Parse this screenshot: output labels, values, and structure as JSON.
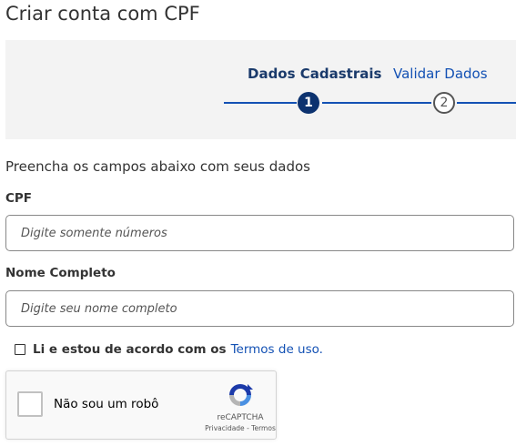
{
  "page": {
    "title": "Criar conta com CPF"
  },
  "stepper": {
    "steps": [
      {
        "label": "Dados Cadastrais",
        "number": "1",
        "state": "active"
      },
      {
        "label": "Validar Dados",
        "number": "2",
        "state": "inactive"
      }
    ]
  },
  "form": {
    "intro": "Preencha os campos abaixo com seus dados",
    "cpf": {
      "label": "CPF",
      "placeholder": "Digite somente números",
      "value": ""
    },
    "nome": {
      "label": "Nome Completo",
      "placeholder": "Digite seu nome completo",
      "value": ""
    },
    "terms": {
      "text": "Li e estou de acordo com os",
      "link": "Termos de uso.",
      "checked": false
    }
  },
  "captcha": {
    "label": "Não sou um robô",
    "brand": "reCAPTCHA",
    "privacy": "Privacidade",
    "separator": " - ",
    "terms": "Termos",
    "icon": "recaptcha-icon",
    "checked": false
  },
  "colors": {
    "primary_blue": "#1351b4",
    "active_step": "#0c326f",
    "stepper_bg": "#f3f3f3"
  }
}
